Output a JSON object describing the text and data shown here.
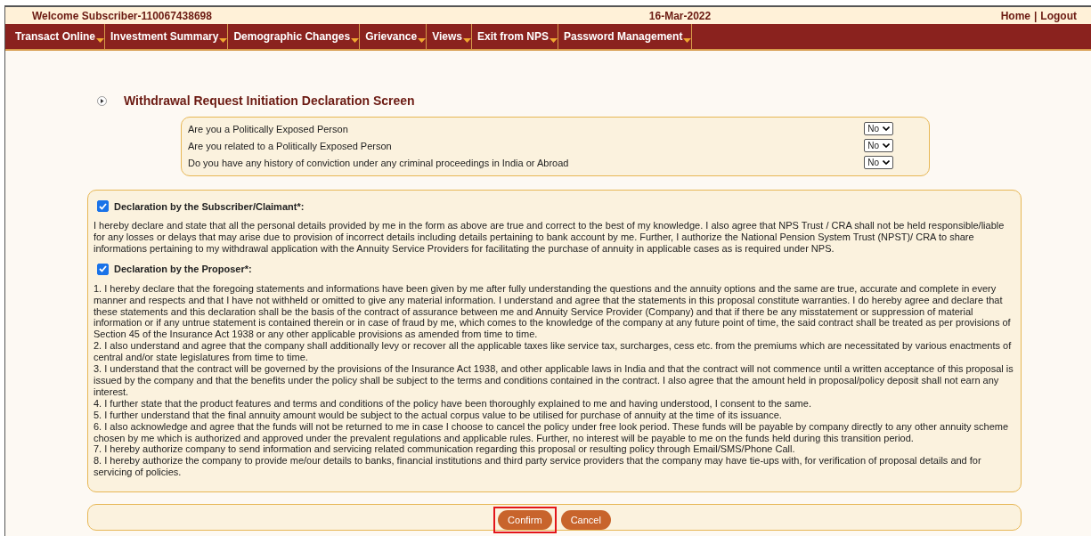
{
  "header": {
    "welcome": "Welcome Subscriber-110067438698",
    "date": "16-Mar-2022",
    "links": [
      {
        "label": "Home"
      },
      {
        "label": "Logout"
      }
    ],
    "separator": "|"
  },
  "menu": [
    {
      "label": "Transact Online"
    },
    {
      "label": "Investment Summary"
    },
    {
      "label": "Demographic Changes"
    },
    {
      "label": "Grievance"
    },
    {
      "label": "Views"
    },
    {
      "label": "Exit from NPS"
    },
    {
      "label": "Password Management"
    }
  ],
  "page_title": "Withdrawal Request Initiation Declaration Screen",
  "questions": [
    {
      "label": "Are you a Politically Exposed Person",
      "value": "No"
    },
    {
      "label": "Are you related to a Politically Exposed Person",
      "value": "No"
    },
    {
      "label": "Do you have any history of conviction under any criminal proceedings in India or Abroad",
      "value": "No"
    }
  ],
  "declarations": [
    {
      "title": "Declaration by the Subscriber/Claimant*:",
      "checked": true,
      "paragraphs": [
        "I hereby declare and state that all the personal details provided by me in the form as above are true and correct to the best of my knowledge. I also agree that NPS Trust / CRA shall not be held responsible/liable for any losses or delays that may arise due to provision of incorrect details including details pertaining to bank account by me. Further, I authorize the National Pension System Trust (NPST)/ CRA to share informations pertaining to my withdrawal application with the Annuity Service Providers for facilitating the purchase of annuity in applicable cases as is required under NPS."
      ]
    },
    {
      "title": "Declaration by the Proposer*:",
      "checked": true,
      "paragraphs": [
        "1. I hereby declare that the foregoing statements and informations have been given by me after fully understanding the questions and the annuity options and the same are true, accurate and complete in every manner and respects and that I have not withheld or omitted to give any material information. I understand and agree that the statements in this proposal constitute warranties. I do hereby agree and declare that these statements and this declaration shall be the basis of the contract of assurance between me and Annuity Service Provider (Company) and that if there be any misstatement or suppression of material information or if any untrue statement is contained therein or in case of fraud by me, which comes to the knowledge of the company at any future point of time, the said contract shall be treated as per provisions of Section 45 of the Insurance Act 1938 or any other applicable provisions as amended from time to time.",
        "2. I also understand and agree that the company shall additionally levy or recover all the applicable taxes like service tax, surcharges, cess etc. from the premiums which are necessitated by various enactments of central and/or state legislatures from time to time.",
        "3. I understand that the contract will be governed by the provisions of the Insurance Act 1938, and other applicable laws in India and that the contract will not commence until a written acceptance of this proposal is issued by the company and that the benefits under the policy shall be subject to the terms and conditions contained in the contract. I also agree that the amount held in proposal/policy deposit shall not earn any interest.",
        "4. I further state that the product features and terms and conditions of the policy have been thoroughly explained to me and having understood, I consent to the same.",
        "5. I further understand that the final annuity amount would be subject to the actual corpus value to be utilised for purchase of annuity at the time of its issuance.",
        "6. I also acknowledge and agree that the funds will not be returned to me in case I choose to cancel the policy under free look period. These funds will be payable by company directly to any other annuity scheme chosen by me which is authorized and approved under the prevalent regulations and applicable rules. Further, no interest will be payable to me on the funds held during this transition period.",
        "7. I hereby authorize company to send information and servicing related communication regarding this proposal or resulting policy through Email/SMS/Phone Call.",
        "8. I hereby authorize the company to provide me/our details to banks, financial institutions and third party service providers that the company may have tie-ups with, for verification of proposal details and for servicing of policies."
      ]
    }
  ],
  "buttons": [
    {
      "label": "Confirm",
      "highlighted": true
    },
    {
      "label": "Cancel",
      "highlighted": false
    }
  ]
}
